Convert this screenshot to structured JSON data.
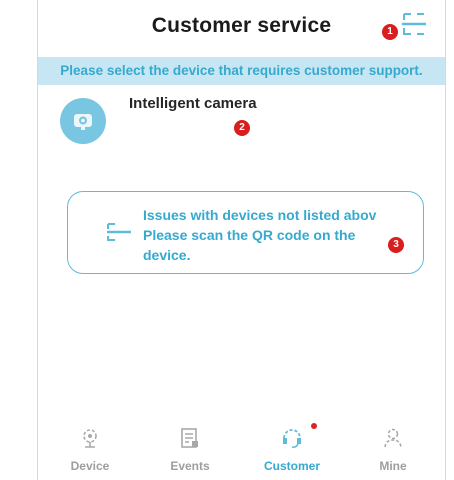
{
  "header": {
    "title": "Customer service",
    "scan_icon": "scan-icon",
    "badge_1": "1"
  },
  "notice": {
    "text": "Please select the device that requires customer support."
  },
  "devices": [
    {
      "name": "Intelligent camera",
      "icon": "camera-icon",
      "badge": "2"
    }
  ],
  "help": {
    "line1": "Issues with devices not listed abov",
    "line2": "Please scan the QR code on the device.",
    "icon": "scan-icon",
    "badge": "3"
  },
  "tabs": [
    {
      "label": "Device",
      "icon": "device-icon",
      "active": false
    },
    {
      "label": "Events",
      "icon": "events-icon",
      "active": false
    },
    {
      "label": "Customer",
      "icon": "customer-icon",
      "active": true,
      "has_dot": true
    },
    {
      "label": "Mine",
      "icon": "mine-icon",
      "active": false
    }
  ],
  "colors": {
    "accent": "#36a9cf",
    "notice_bg": "#c6e6f3",
    "avatar_bg": "#78c6e1",
    "badge_red": "#d81e1e",
    "inactive": "#9e9e9e"
  }
}
